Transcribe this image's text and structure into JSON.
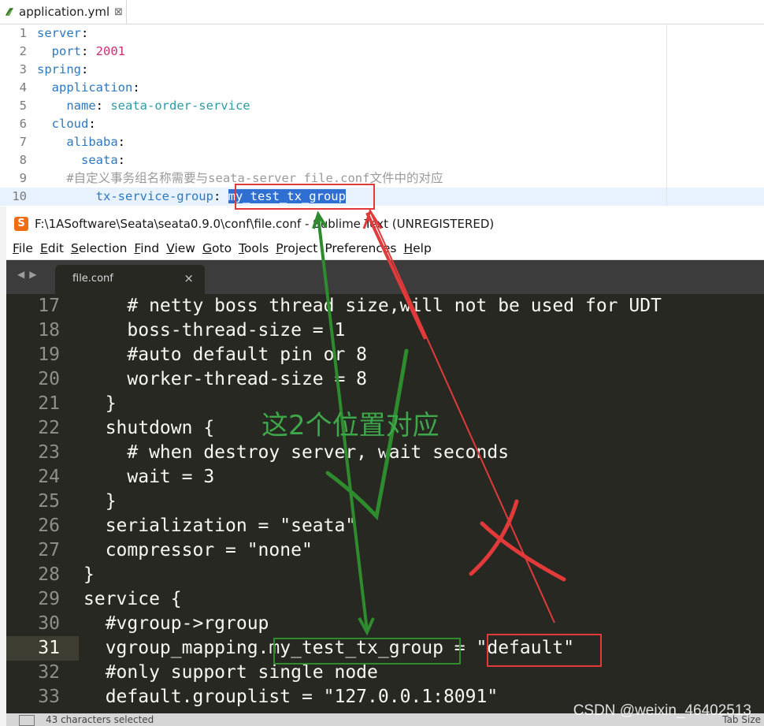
{
  "eclipse": {
    "tab_title": "application.yml",
    "tab_close_icon": "close-icon",
    "lines": [
      {
        "num": "1",
        "segments": [
          {
            "t": "server",
            "c": "k"
          },
          {
            "t": ":",
            "c": "p"
          }
        ]
      },
      {
        "num": "2",
        "segments": [
          {
            "t": "  port",
            "c": "k"
          },
          {
            "t": ": ",
            "c": "p"
          },
          {
            "t": "2001",
            "c": "n"
          }
        ]
      },
      {
        "num": "3",
        "segments": [
          {
            "t": "spring",
            "c": "k"
          },
          {
            "t": ":",
            "c": "p"
          }
        ]
      },
      {
        "num": "4",
        "segments": [
          {
            "t": "  application",
            "c": "k"
          },
          {
            "t": ":",
            "c": "p"
          }
        ]
      },
      {
        "num": "5",
        "segments": [
          {
            "t": "    name",
            "c": "k"
          },
          {
            "t": ": ",
            "c": "p"
          },
          {
            "t": "seata-order-service",
            "c": "v"
          }
        ]
      },
      {
        "num": "6",
        "segments": [
          {
            "t": "  cloud",
            "c": "k"
          },
          {
            "t": ":",
            "c": "p"
          }
        ]
      },
      {
        "num": "7",
        "segments": [
          {
            "t": "    alibaba",
            "c": "k"
          },
          {
            "t": ":",
            "c": "p"
          }
        ]
      },
      {
        "num": "8",
        "segments": [
          {
            "t": "      seata",
            "c": "k"
          },
          {
            "t": ":",
            "c": "p"
          }
        ]
      },
      {
        "num": "9",
        "segments": [
          {
            "t": "    #自定义事务组名称需要与seata-server file.conf文件中的对应",
            "c": "c"
          }
        ]
      },
      {
        "num": "10",
        "segments": [
          {
            "t": "        tx-service-group",
            "c": "k"
          },
          {
            "t": ": ",
            "c": "p"
          },
          {
            "t": "my_test_tx_group",
            "c": "sel"
          }
        ]
      }
    ]
  },
  "sublime": {
    "window_title": "F:\\1ASoftware\\Seata\\seata0.9.0\\conf\\file.conf - Sublime Text (UNREGISTERED)",
    "menu": [
      {
        "u": "F",
        "rest": "ile"
      },
      {
        "u": "E",
        "rest": "dit"
      },
      {
        "u": "S",
        "rest": "election"
      },
      {
        "u": "F",
        "rest": "ind"
      },
      {
        "u": "V",
        "rest": "iew"
      },
      {
        "u": "G",
        "rest": "oto"
      },
      {
        "u": "T",
        "rest": "ools"
      },
      {
        "u": "P",
        "rest": "roject"
      },
      {
        "u": "",
        "rest": "Preferences"
      },
      {
        "u": "H",
        "rest": "elp"
      }
    ],
    "tab_label": "file.conf",
    "tab_close": "×",
    "lines": [
      {
        "num": "17",
        "code": "    # netty boss thread size,will not be used for UDT"
      },
      {
        "num": "18",
        "code": "    boss-thread-size = 1"
      },
      {
        "num": "19",
        "code": "    #auto default pin or 8"
      },
      {
        "num": "20",
        "code": "    worker-thread-size = 8"
      },
      {
        "num": "21",
        "code": "  }"
      },
      {
        "num": "22",
        "code": "  shutdown {"
      },
      {
        "num": "23",
        "code": "    # when destroy server, wait seconds"
      },
      {
        "num": "24",
        "code": "    wait = 3"
      },
      {
        "num": "25",
        "code": "  }"
      },
      {
        "num": "26",
        "code": "  serialization = \"seata\""
      },
      {
        "num": "27",
        "code": "  compressor = \"none\""
      },
      {
        "num": "28",
        "code": "}"
      },
      {
        "num": "29",
        "code": "service {"
      },
      {
        "num": "30",
        "code": "  #vgroup->rgroup"
      },
      {
        "num": "31",
        "code": "  vgroup_mapping.my_test_tx_group = \"default\""
      },
      {
        "num": "32",
        "code": "  #only support single node"
      },
      {
        "num": "33",
        "code": "  default.grouplist = \"127.0.0.1:8091\""
      }
    ],
    "status_left": "43 characters selected",
    "status_right": "Tab Size"
  },
  "annotation": {
    "label": "这2个位置对应",
    "watermark": "CSDN @weixin_46402513",
    "colors": {
      "red": "#e23a3a",
      "green": "#2e8b2e",
      "label": "#3da74a"
    }
  }
}
